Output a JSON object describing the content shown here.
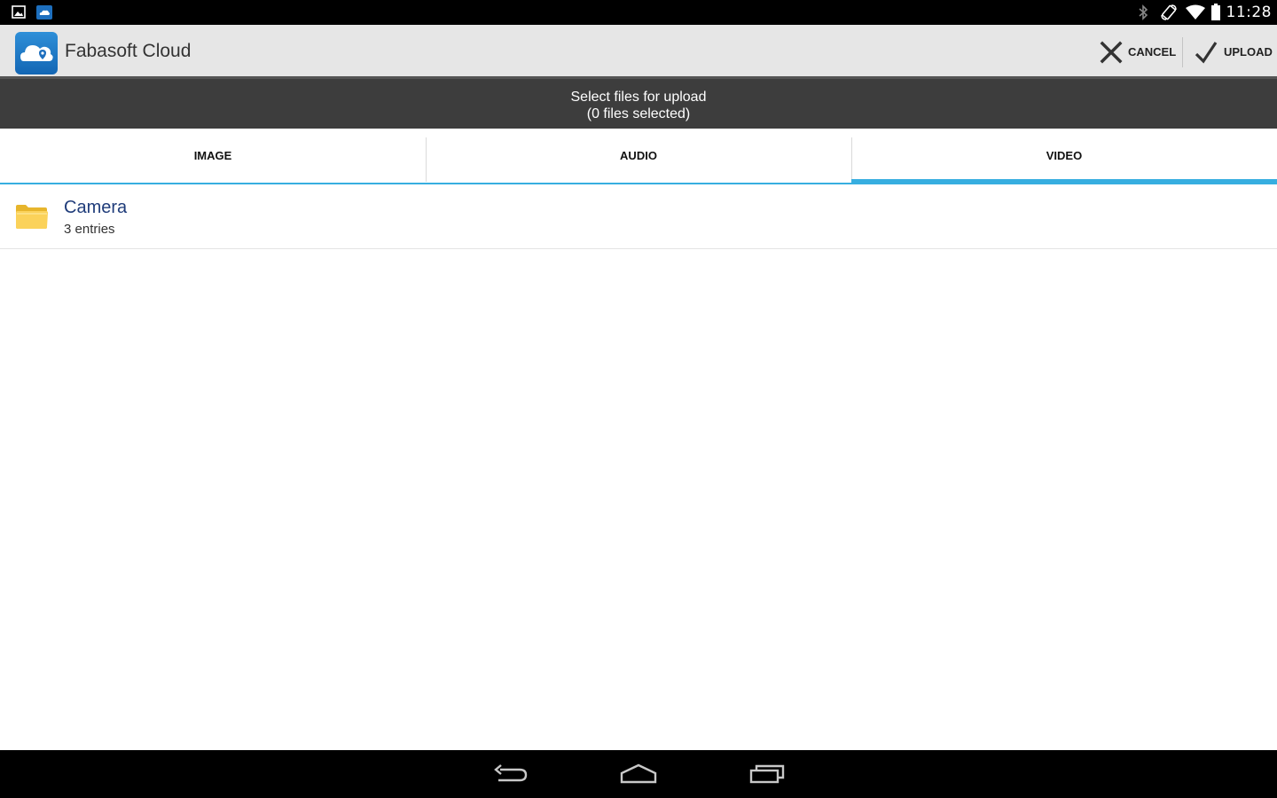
{
  "status_bar": {
    "time": "11:28",
    "left_icons": [
      "image-notification-icon",
      "fabasoft-notification-icon"
    ],
    "right_icons": [
      "bluetooth-icon",
      "rotation-icon",
      "wifi-icon",
      "battery-icon"
    ]
  },
  "action_bar": {
    "app_icon": "fabasoft-cloud-icon",
    "title": "Fabasoft Cloud",
    "cancel_label": "CANCEL",
    "upload_label": "UPLOAD"
  },
  "header": {
    "line1": "Select files for upload",
    "line2": "(0 files selected)"
  },
  "tabs": [
    {
      "label": "IMAGE",
      "active": false
    },
    {
      "label": "AUDIO",
      "active": false
    },
    {
      "label": "VIDEO",
      "active": true
    }
  ],
  "list": [
    {
      "icon": "folder-icon",
      "name": "Camera",
      "subtitle": "3 entries"
    }
  ],
  "nav_bar": {
    "buttons": [
      "back-icon",
      "home-icon",
      "recents-icon"
    ]
  },
  "colors": {
    "accent": "#37aee0",
    "header_bg": "#3d3d3d",
    "action_bar_bg": "#e6e6e6",
    "item_title": "#1f3c7a"
  }
}
